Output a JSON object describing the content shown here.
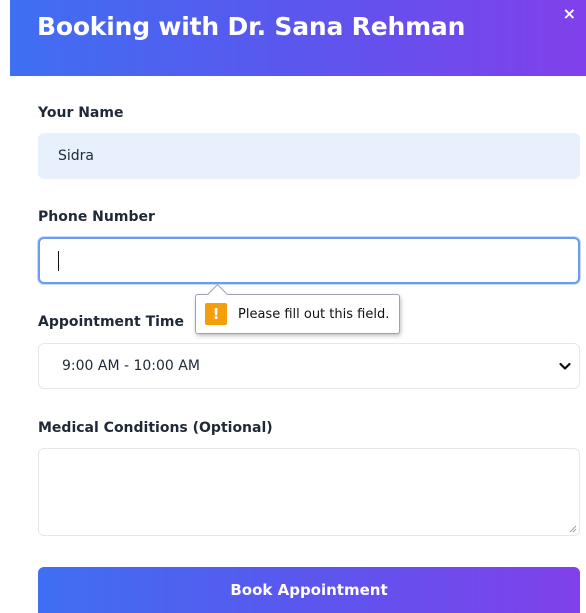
{
  "modal": {
    "title": "Booking with Dr. Sana Rehman",
    "close_label": "×"
  },
  "form": {
    "name": {
      "label": "Your Name",
      "value": "Sidra"
    },
    "phone": {
      "label": "Phone Number",
      "value": ""
    },
    "appointment_time": {
      "label": "Appointment Time",
      "selected": "9:00 AM - 10:00 AM"
    },
    "medical_conditions": {
      "label": "Medical Conditions (Optional)",
      "value": ""
    },
    "submit_label": "Book Appointment"
  },
  "validation_tooltip": {
    "icon": "!",
    "message": "Please fill out this field."
  },
  "colors": {
    "gradient_start": "#3f6ff2",
    "gradient_end": "#8140eb",
    "name_input_bg": "#e8f0fe",
    "focus_border": "#6b9bf2",
    "warning": "#f59e0b"
  },
  "icons": {
    "close": "close-icon",
    "select_arrow": "chevron-down-icon",
    "warning": "warning-icon",
    "textarea_grip": "resize-grip-icon"
  }
}
